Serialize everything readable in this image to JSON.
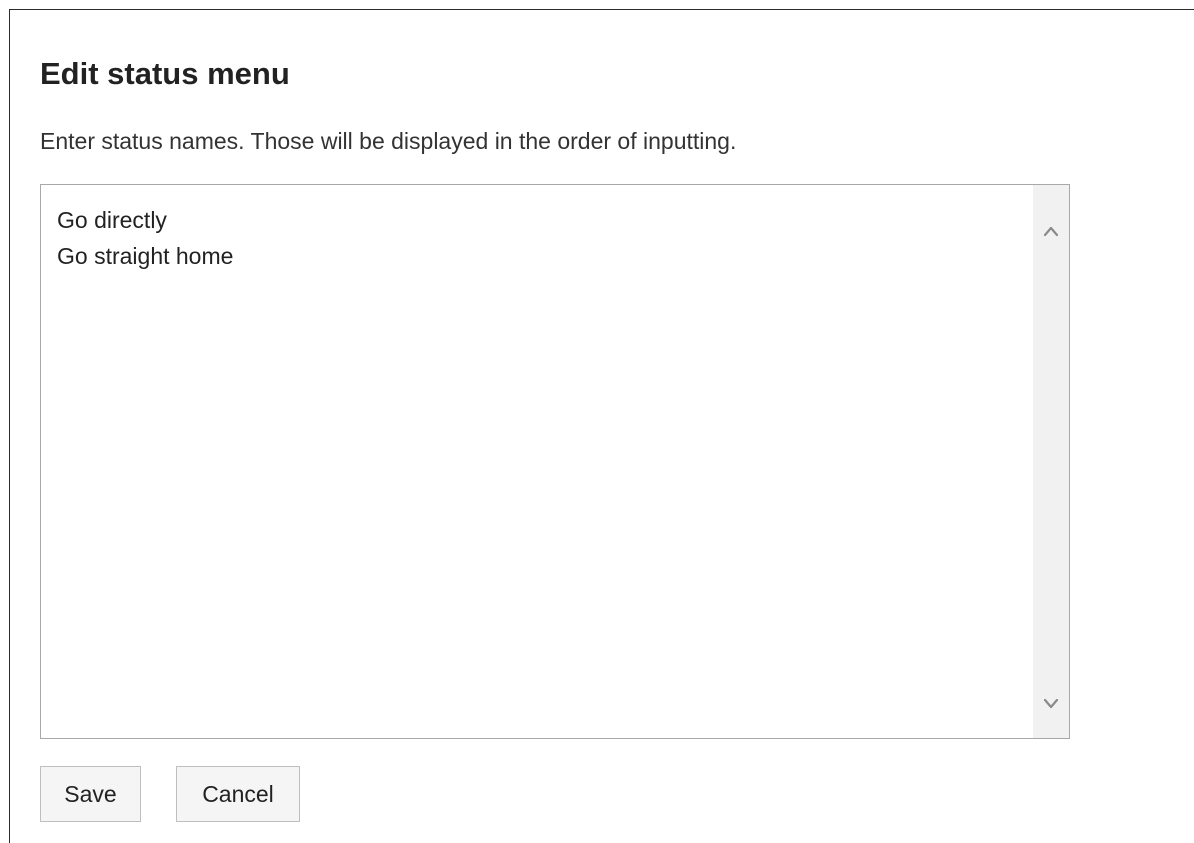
{
  "dialog": {
    "title": "Edit status menu",
    "description": "Enter status names. Those will be displayed in the order of inputting."
  },
  "status_list": {
    "lines": [
      "Go directly",
      "Go straight home"
    ]
  },
  "scrollbar": {
    "up_icon": "chevron-up-icon",
    "down_icon": "chevron-down-icon"
  },
  "actions": {
    "save_label": "Save",
    "cancel_label": "Cancel"
  }
}
